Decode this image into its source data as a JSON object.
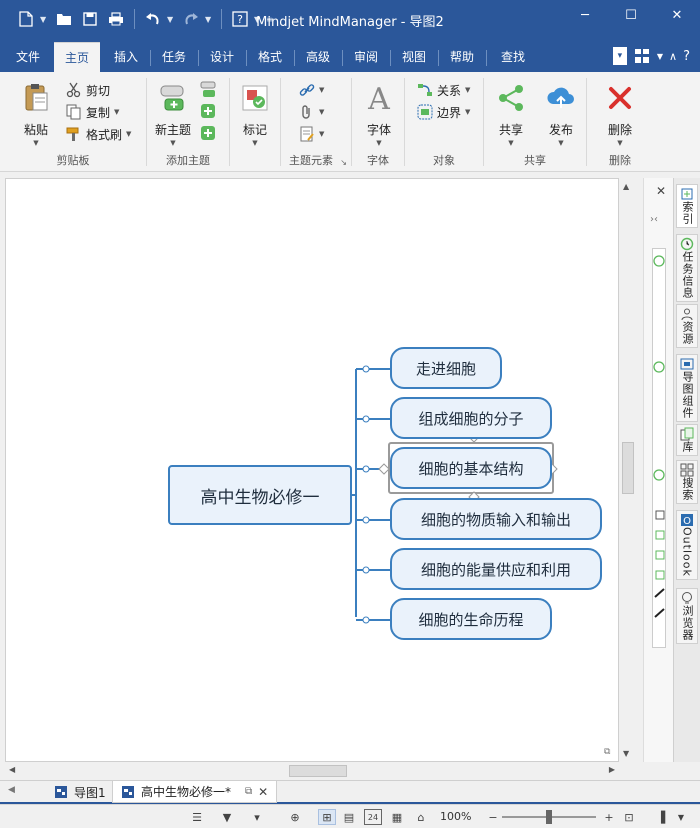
{
  "app": {
    "title": "Mindjet MindManager - 导图2"
  },
  "quick_access": [
    "new-icon",
    "open-icon",
    "save-icon",
    "print-icon",
    "undo-icon",
    "redo-icon",
    "help-icon"
  ],
  "window_controls": {
    "minimize": "─",
    "maximize": "☐",
    "close": "✕"
  },
  "ribbon_tabs": [
    "文件",
    "主页",
    "插入",
    "任务",
    "设计",
    "格式",
    "高级",
    "审阅",
    "视图",
    "帮助",
    "查找"
  ],
  "active_tab": "主页",
  "ribbon": {
    "clipboard": {
      "label": "剪贴板",
      "paste": "粘贴",
      "cut": "剪切",
      "copy": "复制",
      "format_painter": "格式刷"
    },
    "add_topic": {
      "label": "添加主题",
      "new_topic": "新主题"
    },
    "marker": {
      "label": "标记"
    },
    "topic_elements": {
      "label": "主题元素"
    },
    "font": {
      "label": "字体",
      "button": "字体"
    },
    "objects": {
      "label": "对象",
      "relation": "关系",
      "boundary": "边界"
    },
    "share": {
      "label": "共享",
      "share": "共享",
      "publish": "发布"
    },
    "delete": {
      "label": "删除",
      "delete": "删除"
    }
  },
  "mindmap": {
    "central": "高中生物必修一",
    "subtopics": [
      "走进细胞",
      "组成细胞的分子",
      "细胞的基本结构",
      "细胞的物质输入和输出",
      "细胞的能量供应和利用",
      "细胞的生命历程"
    ],
    "selected_index": 2,
    "colors": {
      "border": "#3b7fbf",
      "fill": "#eaf2fb",
      "line": "#3b7fbf"
    }
  },
  "side_tabs": [
    "索引",
    "任务信息",
    "资源",
    "导图组件",
    "库",
    "搜索",
    "Outlook",
    "浏览器"
  ],
  "doc_tabs": [
    {
      "label": "导图1",
      "active": false
    },
    {
      "label": "高中生物必修一*",
      "active": true
    }
  ],
  "status": {
    "zoom": "100%",
    "calendar_day": "24"
  }
}
